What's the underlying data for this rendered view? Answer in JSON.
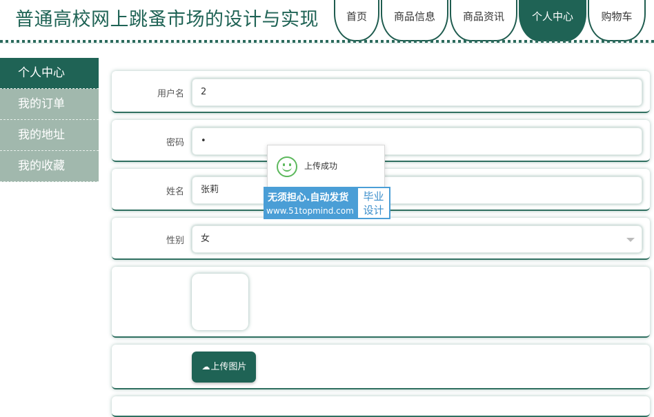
{
  "header": {
    "title": "普通高校网上跳蚤市场的设计与实现",
    "nav": [
      "首页",
      "商品信息",
      "商品资讯",
      "个人中心",
      "购物车"
    ],
    "active_nav": "个人中心"
  },
  "sidebar": {
    "items": [
      {
        "label": "个人中心",
        "active": true
      },
      {
        "label": "我的订单",
        "active": false
      },
      {
        "label": "我的地址",
        "active": false
      },
      {
        "label": "我的收藏",
        "active": false
      }
    ]
  },
  "form": {
    "username": {
      "label": "用户名",
      "value": "2"
    },
    "password": {
      "label": "密码",
      "value": "•"
    },
    "name": {
      "label": "姓名",
      "value": "张莉"
    },
    "gender": {
      "label": "性别",
      "value": "女"
    },
    "upload_label": "上传图片"
  },
  "toast": {
    "text": "上传成功"
  },
  "ad": {
    "line1": "无须担心.自动发货",
    "line2": "www.51topmind.com",
    "badge_line1": "毕业",
    "badge_line2": "设计"
  },
  "colors": {
    "primary": "#1f6355",
    "sidebar_inactive": "#a1b8ad",
    "ad_blue": "#4a9ed6"
  }
}
